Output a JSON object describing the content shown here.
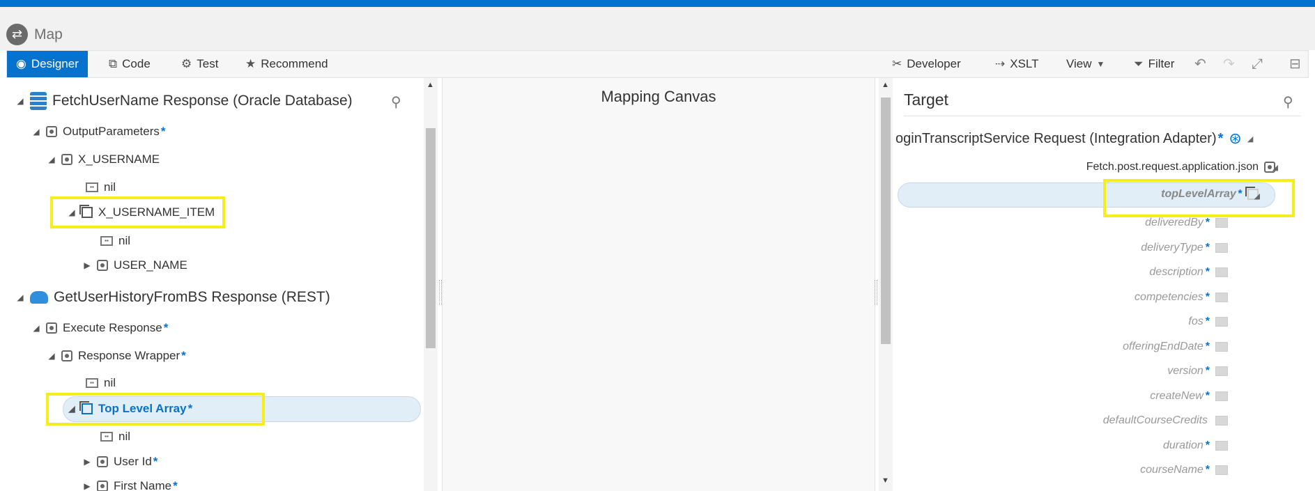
{
  "app": {
    "title": "Map"
  },
  "toolbar": {
    "designer": "Designer",
    "code": "Code",
    "test": "Test",
    "recommend": "Recommend",
    "developer": "Developer",
    "xslt": "XSLT",
    "view": "View",
    "filter": "Filter"
  },
  "source": {
    "root1": "FetchUserName Response (Oracle Database)",
    "output_parameters": "OutputParameters",
    "x_username": "X_USERNAME",
    "nil1": "nil",
    "x_username_item": "X_USERNAME_ITEM",
    "nil2": "nil",
    "user_name": "USER_NAME",
    "root2": "GetUserHistoryFromBS Response (REST)",
    "execute_response": "Execute Response",
    "response_wrapper": "Response Wrapper",
    "nil3": "nil",
    "top_level_array": "Top Level Array",
    "nil4": "nil",
    "user_id": "User Id",
    "first_name": "First Name",
    "required_mark": "*"
  },
  "canvas": {
    "title": "Mapping Canvas"
  },
  "target": {
    "title": "Target",
    "root": "oginTranscriptService Request (Integration Adapter)",
    "fetch": "Fetch.post.request.application.json",
    "top_level_array": "topLevelArray",
    "fields": [
      {
        "name": "deliveredBy",
        "required": "*"
      },
      {
        "name": "deliveryType",
        "required": "*"
      },
      {
        "name": "description",
        "required": "*"
      },
      {
        "name": "competencies",
        "required": "*"
      },
      {
        "name": "fos",
        "required": "*"
      },
      {
        "name": "offeringEndDate",
        "required": "*"
      },
      {
        "name": "version",
        "required": "*"
      },
      {
        "name": "createNew",
        "required": "*"
      },
      {
        "name": "defaultCourseCredits",
        "required": ""
      },
      {
        "name": "duration",
        "required": "*"
      },
      {
        "name": "courseName",
        "required": "*"
      }
    ]
  },
  "colors": {
    "accent": "#0572ce",
    "highlight": "#f5ee1a",
    "selection": "#e1eef8"
  }
}
